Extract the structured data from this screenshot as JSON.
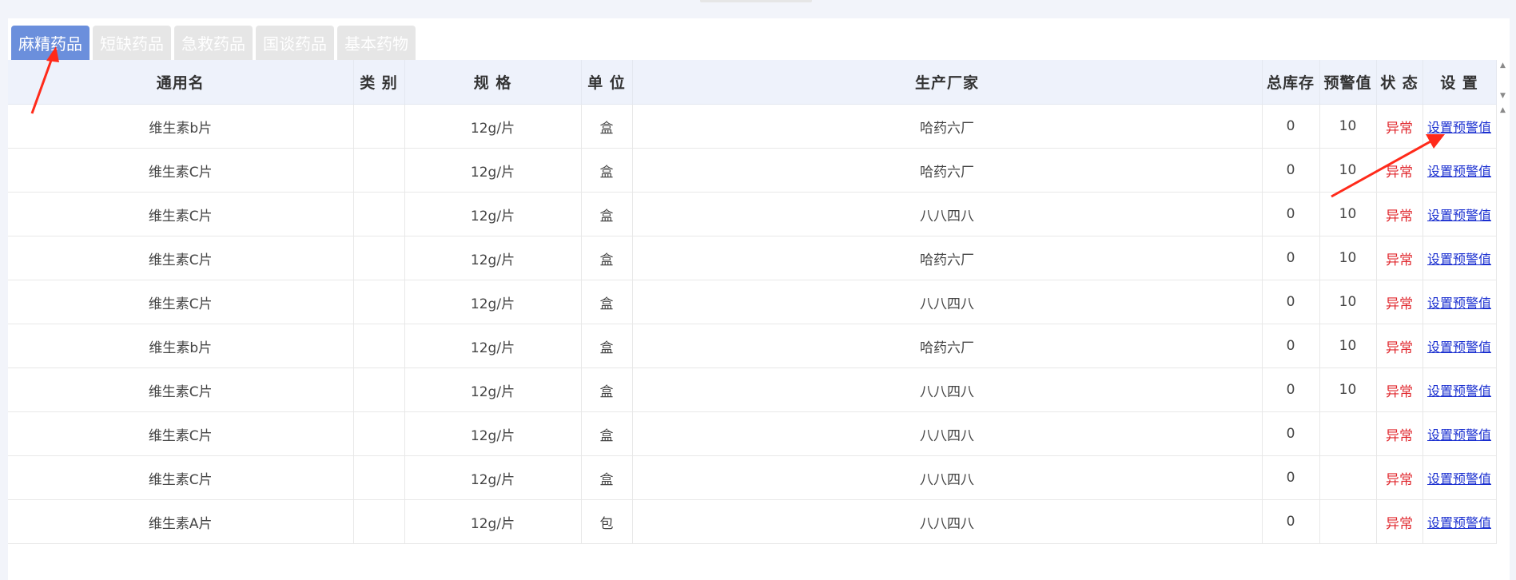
{
  "tabs": [
    {
      "label": "麻精药品",
      "active": true
    },
    {
      "label": "短缺药品",
      "active": false
    },
    {
      "label": "急救药品",
      "active": false
    },
    {
      "label": "国谈药品",
      "active": false
    },
    {
      "label": "基本药物",
      "active": false
    }
  ],
  "table": {
    "headers": {
      "name": "通用名",
      "category": "类 别",
      "spec": "规 格",
      "unit": "单 位",
      "manufacturer": "生产厂家",
      "stock": "总库存",
      "warning": "预警值",
      "status": "状 态",
      "setting": "设 置"
    },
    "rows": [
      {
        "name": "维生素b片",
        "category": "",
        "spec": "12g/片",
        "unit": "盒",
        "manufacturer": "哈药六厂",
        "stock": "0",
        "warning": "10",
        "status": "异常",
        "setting": "设置预警值"
      },
      {
        "name": "维生素C片",
        "category": "",
        "spec": "12g/片",
        "unit": "盒",
        "manufacturer": "哈药六厂",
        "stock": "0",
        "warning": "10",
        "status": "异常",
        "setting": "设置预警值"
      },
      {
        "name": "维生素C片",
        "category": "",
        "spec": "12g/片",
        "unit": "盒",
        "manufacturer": "八八四八",
        "stock": "0",
        "warning": "10",
        "status": "异常",
        "setting": "设置预警值"
      },
      {
        "name": "维生素C片",
        "category": "",
        "spec": "12g/片",
        "unit": "盒",
        "manufacturer": "哈药六厂",
        "stock": "0",
        "warning": "10",
        "status": "异常",
        "setting": "设置预警值"
      },
      {
        "name": "维生素C片",
        "category": "",
        "spec": "12g/片",
        "unit": "盒",
        "manufacturer": "八八四八",
        "stock": "0",
        "warning": "10",
        "status": "异常",
        "setting": "设置预警值"
      },
      {
        "name": "维生素b片",
        "category": "",
        "spec": "12g/片",
        "unit": "盒",
        "manufacturer": "哈药六厂",
        "stock": "0",
        "warning": "10",
        "status": "异常",
        "setting": "设置预警值"
      },
      {
        "name": "维生素C片",
        "category": "",
        "spec": "12g/片",
        "unit": "盒",
        "manufacturer": "八八四八",
        "stock": "0",
        "warning": "10",
        "status": "异常",
        "setting": "设置预警值"
      },
      {
        "name": "维生素C片",
        "category": "",
        "spec": "12g/片",
        "unit": "盒",
        "manufacturer": "八八四八",
        "stock": "0",
        "warning": "",
        "status": "异常",
        "setting": "设置预警值"
      },
      {
        "name": "维生素C片",
        "category": "",
        "spec": "12g/片",
        "unit": "盒",
        "manufacturer": "八八四八",
        "stock": "0",
        "warning": "",
        "status": "异常",
        "setting": "设置预警值"
      },
      {
        "name": "维生素A片",
        "category": "",
        "spec": "12g/片",
        "unit": "包",
        "manufacturer": "八八四八",
        "stock": "0",
        "warning": "",
        "status": "异常",
        "setting": "设置预警值"
      }
    ]
  },
  "colors": {
    "active_tab": "#6b8fdc",
    "inactive_tab": "#e6e6e6",
    "status_abnormal": "#e0282e",
    "link": "#1a2fd0",
    "annotation_arrow": "#ff2a1a"
  }
}
